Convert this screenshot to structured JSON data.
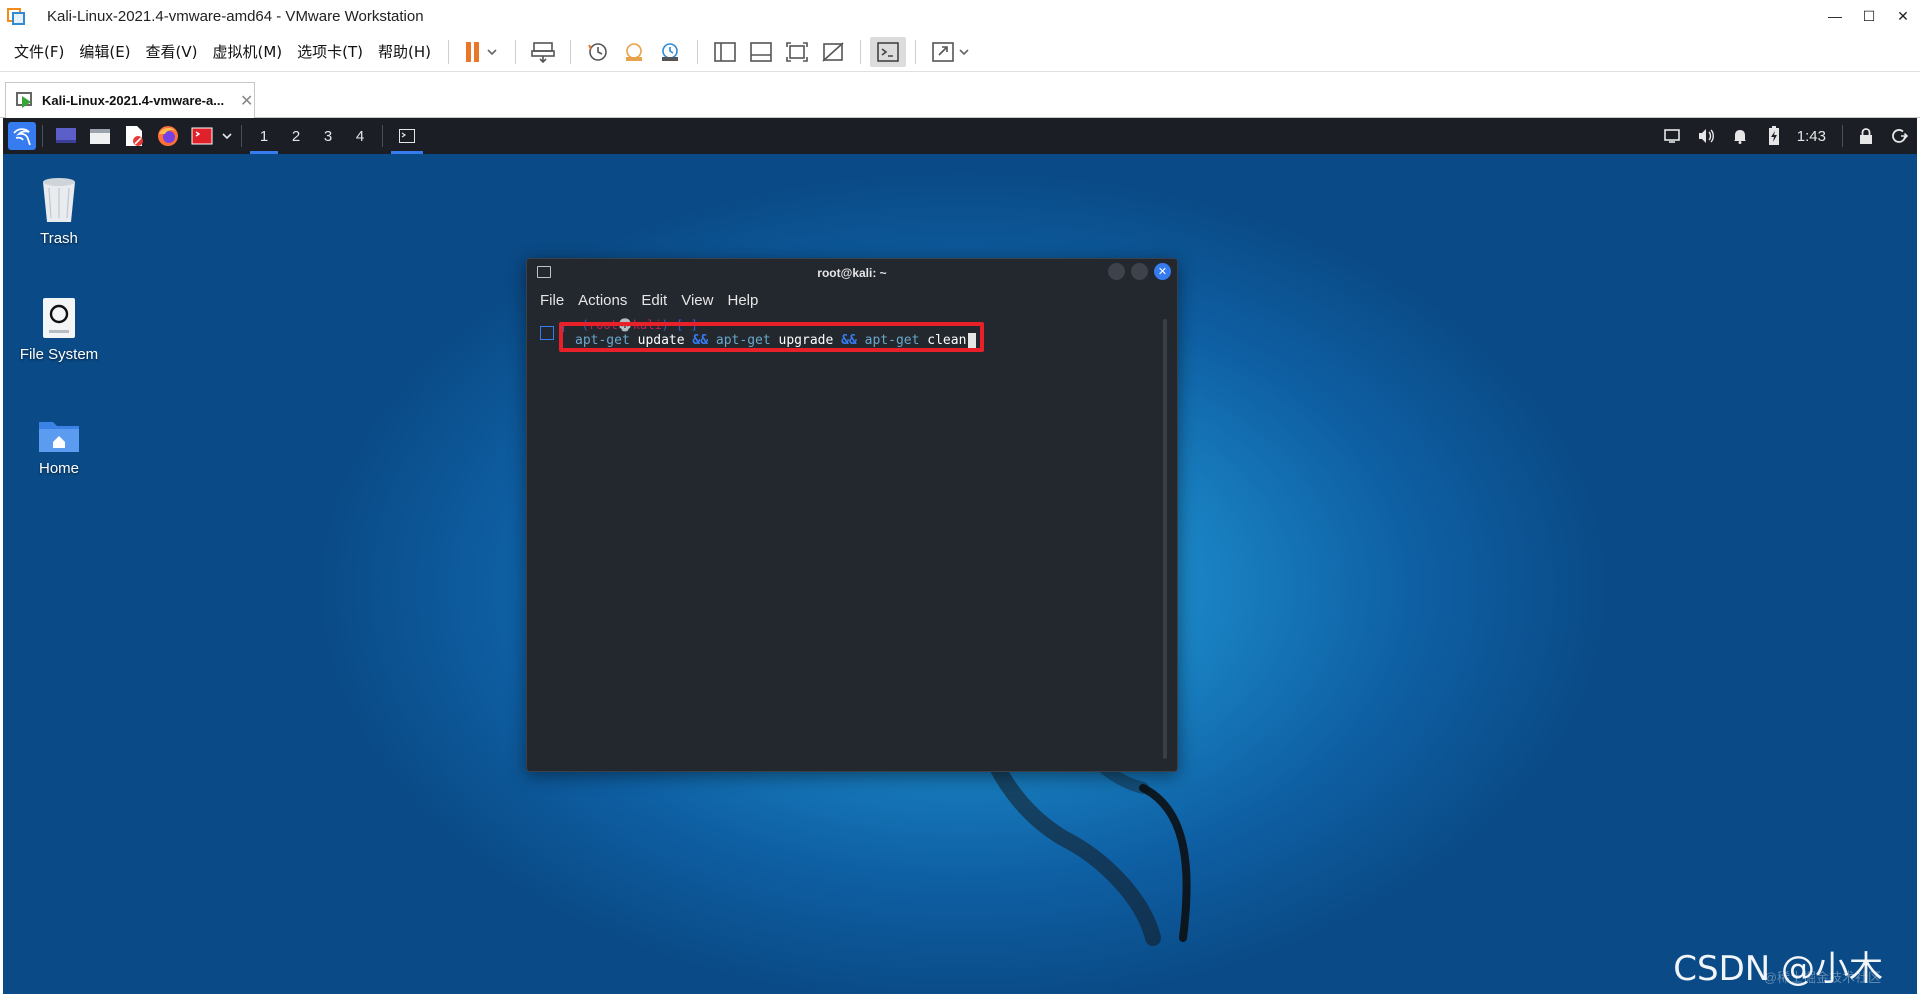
{
  "window": {
    "title": "Kali-Linux-2021.4-vmware-amd64 - VMware Workstation",
    "controls": [
      "—",
      "☐",
      "✕"
    ]
  },
  "menubar": {
    "items": [
      "文件(F)",
      "编辑(E)",
      "查看(V)",
      "虚拟机(M)",
      "选项卡(T)",
      "帮助(H)"
    ]
  },
  "tab": {
    "label": "Kali-Linux-2021.4-vmware-a...",
    "close": "✕"
  },
  "kali_panel": {
    "workspaces": [
      "1",
      "2",
      "3",
      "4"
    ],
    "active_workspace": "1",
    "clock": "1:43"
  },
  "desktop": {
    "icons": [
      {
        "label": "Trash"
      },
      {
        "label": "File System"
      },
      {
        "label": "Home"
      }
    ]
  },
  "terminal": {
    "title": "root@kali: ~",
    "menu": [
      "File",
      "Actions",
      "Edit",
      "View",
      "Help"
    ],
    "prompt_user": "root",
    "prompt_host": "kali",
    "prompt_dir": "~",
    "command": {
      "p1": "apt-get",
      "a1": " update ",
      "op1": "&&",
      "p2": " apt-get",
      "a2": " upgrade ",
      "op2": "&&",
      "p3": " apt-get",
      "a3": " clean"
    }
  },
  "watermark": {
    "text": "CSDN @小木",
    "sub": "@稀土掘金技术社区"
  },
  "colors": {
    "kali_blue": "#367bf0",
    "highlight_red": "#e8202a",
    "terminal_bg": "#23272e",
    "panel_bg": "#1b1f25"
  }
}
